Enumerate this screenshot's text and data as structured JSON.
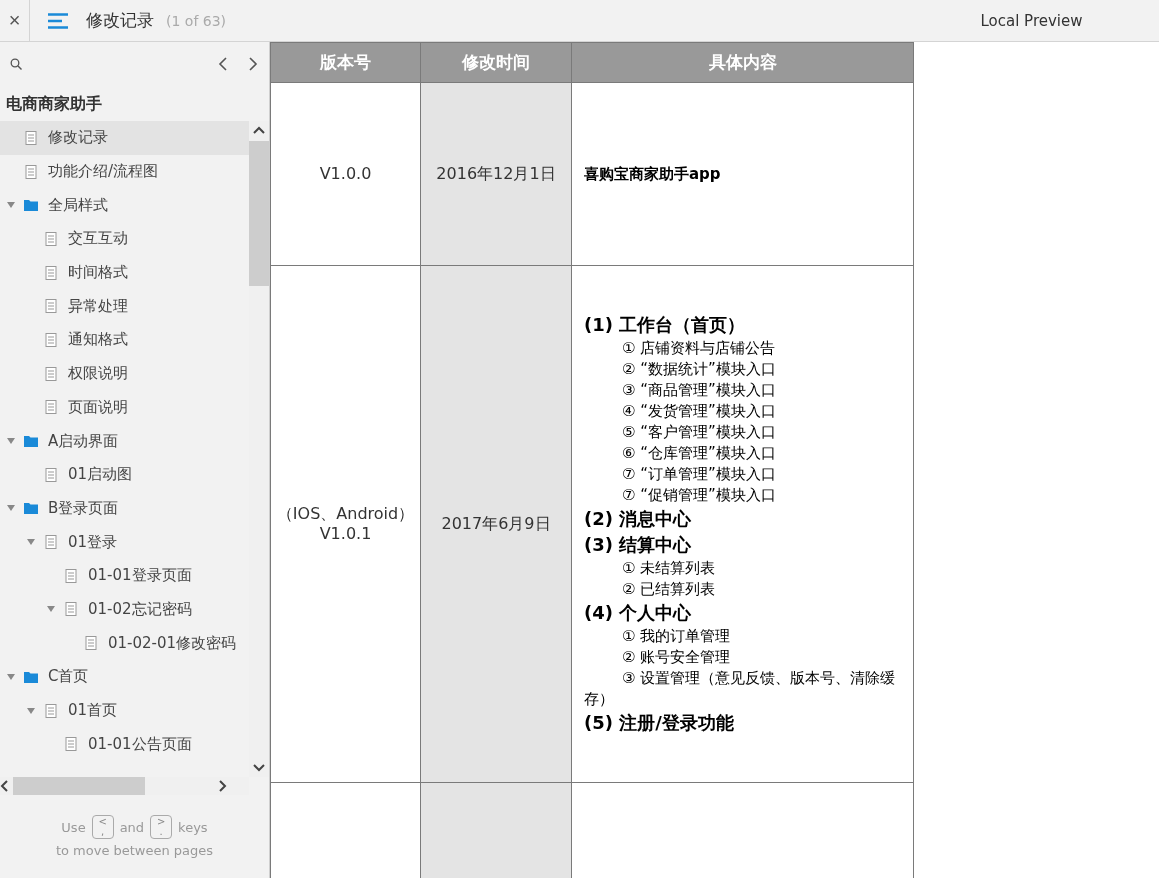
{
  "topbar": {
    "close": "×",
    "title": "修改记录",
    "page_count": "(1 of 63)",
    "preview": "Local Preview"
  },
  "sidebar": {
    "project": "电商商家助手",
    "tree": [
      {
        "label": "修改记录",
        "kind": "page",
        "selected": true
      },
      {
        "label": "功能介绍/流程图",
        "kind": "page",
        "selected": false
      },
      {
        "label": "全局样式",
        "kind": "folder",
        "selected": false,
        "expanded": true,
        "children": [
          {
            "label": "交互互动",
            "kind": "page",
            "selected": false
          },
          {
            "label": "时间格式",
            "kind": "page",
            "selected": false
          },
          {
            "label": "异常处理",
            "kind": "page",
            "selected": false
          },
          {
            "label": "通知格式",
            "kind": "page",
            "selected": false
          },
          {
            "label": "权限说明",
            "kind": "page",
            "selected": false
          },
          {
            "label": "页面说明",
            "kind": "page",
            "selected": false
          }
        ]
      },
      {
        "label": "A启动界面",
        "kind": "folder",
        "selected": false,
        "expanded": true,
        "children": [
          {
            "label": "01启动图",
            "kind": "page",
            "selected": false
          }
        ]
      },
      {
        "label": "B登录页面",
        "kind": "folder",
        "selected": false,
        "expanded": true,
        "children": [
          {
            "label": "01登录",
            "kind": "page",
            "selected": false,
            "expanded": true,
            "children": [
              {
                "label": "01-01登录页面",
                "kind": "page",
                "selected": false
              },
              {
                "label": "01-02忘记密码",
                "kind": "page",
                "selected": false,
                "expanded": true,
                "children": [
                  {
                    "label": "01-02-01修改密码",
                    "kind": "page",
                    "selected": false
                  }
                ]
              }
            ]
          }
        ]
      },
      {
        "label": "C首页",
        "kind": "folder",
        "selected": false,
        "expanded": true,
        "children": [
          {
            "label": "01首页",
            "kind": "page",
            "selected": false,
            "expanded": true,
            "children": [
              {
                "label": "01-01公告页面",
                "kind": "page",
                "selected": false
              }
            ]
          }
        ]
      }
    ],
    "hint": {
      "use": "Use",
      "key_prev": {
        "top": "<",
        "bottom": ","
      },
      "and": "and",
      "key_next": {
        "top": ">",
        "bottom": "."
      },
      "keys": "keys",
      "line2": "to move between pages"
    }
  },
  "table": {
    "columns": [
      "版本号",
      "修改时间",
      "具体内容"
    ],
    "rows": [
      {
        "version": [
          "V1.0.0"
        ],
        "date": "2016年12月1日",
        "content": [
          {
            "kind": "title",
            "text": "喜购宝商家助手app"
          }
        ]
      },
      {
        "version": [
          "（IOS、Android）",
          "V1.0.1"
        ],
        "date": "2017年6月9日",
        "content": [
          {
            "kind": "heading",
            "text": "(1) 工作台（首页）"
          },
          {
            "kind": "item",
            "text": "① 店铺资料与店铺公告"
          },
          {
            "kind": "item",
            "text": "② “数据统计”模块入口"
          },
          {
            "kind": "item",
            "text": "③ “商品管理”模块入口"
          },
          {
            "kind": "item",
            "text": "④ “发货管理”模块入口"
          },
          {
            "kind": "item",
            "text": "⑤ “客户管理”模块入口"
          },
          {
            "kind": "item",
            "text": "⑥ “仓库管理”模块入口"
          },
          {
            "kind": "item",
            "text": "⑦ “订单管理”模块入口"
          },
          {
            "kind": "item",
            "text": "⑦ “促销管理”模块入口"
          },
          {
            "kind": "heading",
            "text": "(2) 消息中心"
          },
          {
            "kind": "heading",
            "text": "(3) 结算中心"
          },
          {
            "kind": "item",
            "text": "① 未结算列表"
          },
          {
            "kind": "item",
            "text": "② 已结算列表"
          },
          {
            "kind": "heading",
            "text": "(4) 个人中心"
          },
          {
            "kind": "item",
            "text": "① 我的订单管理"
          },
          {
            "kind": "item",
            "text": "② 账号安全管理"
          },
          {
            "kind": "item",
            "text": "③ 设置管理（意见反馈、版本号、清除缓存）"
          },
          {
            "kind": "heading",
            "text": "(5) 注册/登录功能"
          }
        ]
      },
      {
        "version": [],
        "date": "",
        "content": []
      }
    ]
  }
}
